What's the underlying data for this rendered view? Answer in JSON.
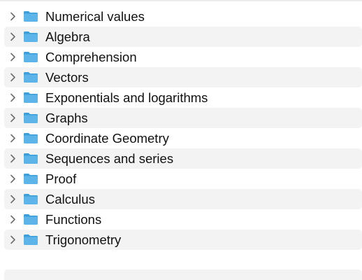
{
  "icons": {
    "disclosure": "chevron-right-icon",
    "folder": "folder-icon"
  },
  "colors": {
    "folder_blue": "#5cb4e8",
    "folder_tab": "#3d9ed9",
    "row_alt": "#f3f3f3",
    "chevron": "#6e6e6e"
  },
  "folders": [
    {
      "label": "Numerical values"
    },
    {
      "label": "Algebra"
    },
    {
      "label": "Comprehension"
    },
    {
      "label": "Vectors"
    },
    {
      "label": "Exponentials and logarithms"
    },
    {
      "label": "Graphs"
    },
    {
      "label": "Coordinate Geometry"
    },
    {
      "label": "Sequences and series"
    },
    {
      "label": "Proof"
    },
    {
      "label": "Calculus"
    },
    {
      "label": "Functions"
    },
    {
      "label": "Trigonometry"
    }
  ]
}
